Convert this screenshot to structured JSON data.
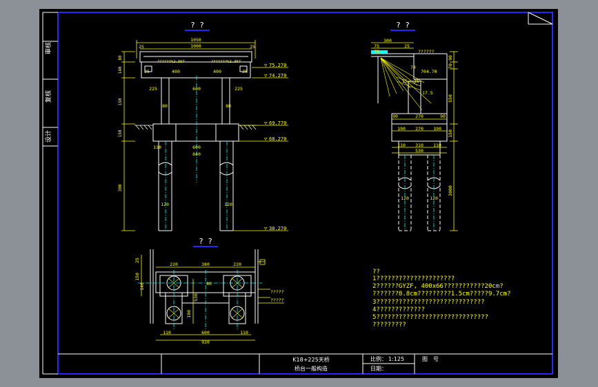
{
  "colors": {
    "background_outer": "#8c9097",
    "sheet": "#000000",
    "frame": "#2626ff",
    "line": "#ffffff",
    "dim": "#ffff00",
    "hatch": "#00ffff",
    "axis": "#00ffff",
    "leader": "#ffff00"
  },
  "views": {
    "elevation_title": "? ?",
    "side_title": "? ?",
    "plan_title": "? ?"
  },
  "elevation": {
    "dims": {
      "top_overall": "1050",
      "top_inner": "1000",
      "left_small": "25",
      "right_small": "25",
      "beam_left": "25",
      "beam_mid_left": "400",
      "beam_mid_right": "400",
      "beam_right": "25",
      "cap_left": "225",
      "cap_mid": "600",
      "cap_right": "225",
      "col_left": "80",
      "col_right": "80",
      "footing_left": "110",
      "footing_mid": "600",
      "footing_total": "840",
      "pile_left": "120",
      "pile_right": "120",
      "height_1": "80",
      "height_2": "140",
      "height_3": "150",
      "height_4": "150",
      "height_5": "300"
    },
    "slope_labels": [
      "??????%2.367",
      "???????%2.367"
    ],
    "elevations": [
      "75.270",
      "74.270",
      "69.770",
      "68.270",
      "38.270"
    ]
  },
  "side": {
    "dims": {
      "top_1": "300",
      "top_2": "25",
      "top_3": "75",
      "top_4": "75",
      "note_1": "??????",
      "elev_1": "704.70",
      "mid_1": "70",
      "mid_2": "15",
      "mid_3": "15",
      "mid_4": "17.5",
      "cap_1": "90",
      "cap_2": "270",
      "cap_3": "90",
      "foot_1": "190",
      "foot_2": "270",
      "foot_3": "190",
      "base_1": "110",
      "base_2": "310",
      "base_3": "110",
      "base_total": "530",
      "pile_1": "120",
      "pile_2": "120",
      "h1": "90",
      "h2": "70",
      "h3": "550",
      "h4": "150",
      "h5": "3000"
    }
  },
  "plan": {
    "dims": {
      "top_1": "220",
      "top_2": "380",
      "top_3": "220",
      "left_1": "25",
      "left_2": "150",
      "left_3": "140",
      "mid_1": "80",
      "mid_2": "530",
      "mid_3": "190",
      "bot_1": "110",
      "bot_2": "600",
      "bot_3": "110",
      "bot_total": "920",
      "callout_1": "?????",
      "callout_2": "?????"
    }
  },
  "notes": {
    "heading": "??",
    "lines": [
      "1?????????????????????",
      "2??????GYZF, 400x66???????????20cm?",
      "   ???????8.8cm?????????1.5cm?????9.7cm?",
      "3?????????????????????????????",
      "4?????????????",
      "5??????????????????????????????",
      "   ?????????"
    ]
  },
  "sidebar": {
    "labels": [
      "审核",
      "复核",
      "设计"
    ]
  },
  "title_block": {
    "project": "K18+225天桥",
    "drawing": "桥台一般构造",
    "scale_label": "比例：",
    "scale_value": "1:125",
    "date_label": "日期：",
    "sheet_label": "图　号"
  }
}
